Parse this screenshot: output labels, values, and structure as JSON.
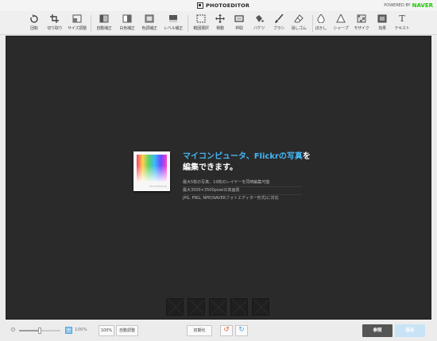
{
  "header": {
    "logo_text": "PHOTOEDITOR",
    "powered_by": "POWERED BY",
    "powered_brand": "NAVER"
  },
  "toolbar": {
    "tools": [
      {
        "id": "rotate",
        "label": "回転",
        "icon": "rotate-icon"
      },
      {
        "id": "crop",
        "label": "切り取り",
        "icon": "crop-icon"
      },
      {
        "id": "resize",
        "label": "サイズ調整",
        "icon": "resize-icon"
      },
      {
        "id": "auto-correct",
        "label": "自動補正",
        "icon": "auto-correct-icon"
      },
      {
        "id": "white-balance",
        "label": "白色補正",
        "icon": "white-balance-icon"
      },
      {
        "id": "color-correct",
        "label": "色調補正",
        "icon": "color-correct-icon"
      },
      {
        "id": "level-correct",
        "label": "レベル補正",
        "icon": "level-correct-icon"
      },
      {
        "id": "range-select",
        "label": "範囲選択",
        "icon": "range-select-icon"
      },
      {
        "id": "move",
        "label": "移動",
        "icon": "move-icon"
      },
      {
        "id": "frame",
        "label": "枠取",
        "icon": "frame-icon"
      },
      {
        "id": "bucket",
        "label": "バケツ",
        "icon": "bucket-icon"
      },
      {
        "id": "brush",
        "label": "ブラシ",
        "icon": "brush-icon"
      },
      {
        "id": "eraser",
        "label": "消しゴム",
        "icon": "eraser-icon"
      },
      {
        "id": "blur",
        "label": "ぼかし",
        "icon": "blur-icon"
      },
      {
        "id": "sharpen",
        "label": "シャープ",
        "icon": "sharpen-icon"
      },
      {
        "id": "mosaic",
        "label": "モザイク",
        "icon": "mosaic-icon"
      },
      {
        "id": "effects",
        "label": "効果",
        "icon": "effects-icon"
      },
      {
        "id": "text",
        "label": "テキスト",
        "icon": "text-icon"
      }
    ]
  },
  "welcome": {
    "headline_part1": "マイコンピュータ、Flickrの写真",
    "headline_part2": "を",
    "headline_line2": "編集できます。",
    "thumb_caption": "PHOTOEDITOR",
    "descriptions": [
      "最大5枚の写真、10枚のレイヤーを同時編集可能",
      "最大3500×3500pixelの高画質",
      "JPG, PNG, NPE(NAVERフォトエディター形式)に対応"
    ]
  },
  "bottombar": {
    "zoom_value": "100%",
    "zoom_level": 0.5,
    "zoom_in_label": "+",
    "btn_100": "100%",
    "btn_auto_fit": "自動調整",
    "btn_reset": "初期化",
    "undo_label": "↺",
    "redo_label": "↻",
    "btn_open": "参照",
    "btn_save": "保存"
  },
  "colors": {
    "accent": "#45b6f5",
    "workspace": "#2a2a2a",
    "naver_green": "#1ec800"
  }
}
